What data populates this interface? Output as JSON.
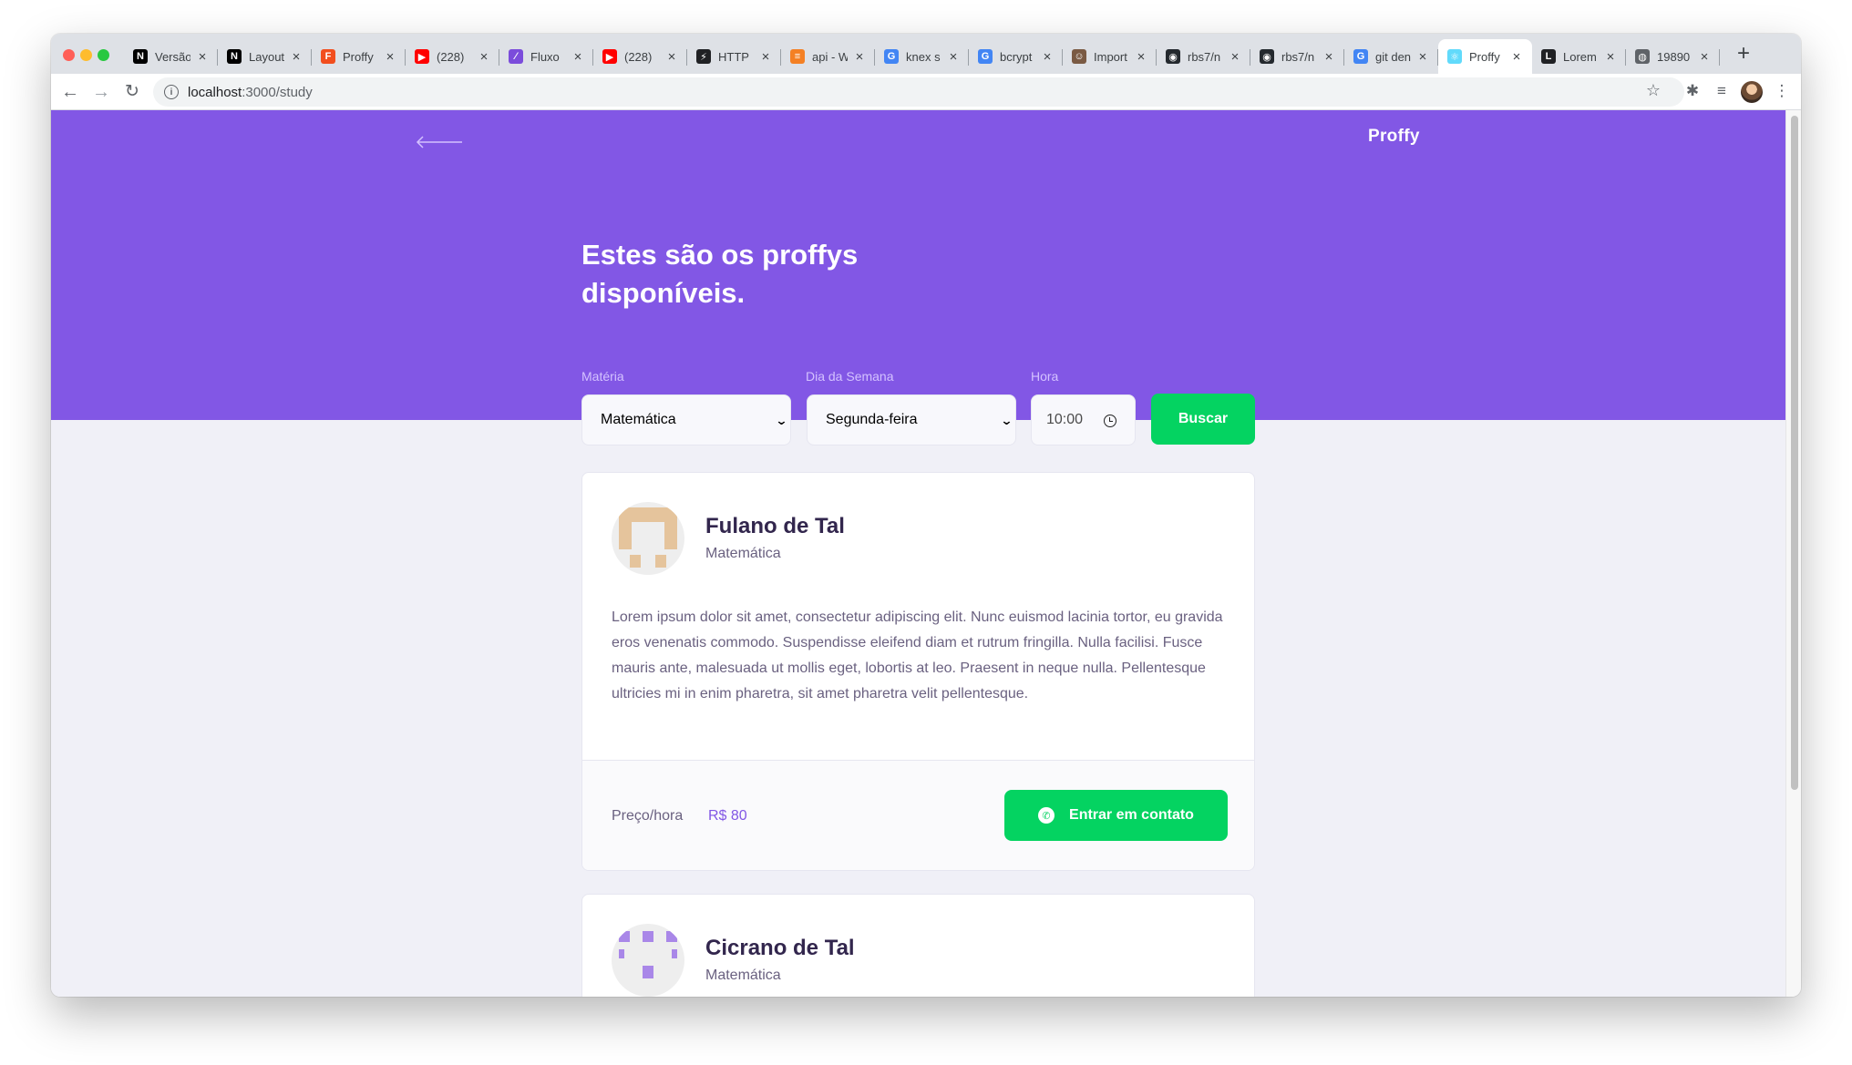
{
  "browser": {
    "tabs": [
      {
        "label": "Versão",
        "favicon": "notion-icon",
        "color": "#000000",
        "glyph": "N"
      },
      {
        "label": "Layout",
        "favicon": "notion-icon",
        "color": "#000000",
        "glyph": "N"
      },
      {
        "label": "Proffy",
        "favicon": "figma-icon",
        "color": "#f24e1e",
        "glyph": "F"
      },
      {
        "label": "(228)",
        "favicon": "youtube-icon",
        "color": "#ff0000",
        "glyph": "▶"
      },
      {
        "label": "Fluxo",
        "favicon": "whimsical-icon",
        "color": "#7b4cdb",
        "glyph": "⁄"
      },
      {
        "label": "(228)",
        "favicon": "youtube-icon",
        "color": "#ff0000",
        "glyph": "▶"
      },
      {
        "label": "HTTP",
        "favicon": "bolt-icon",
        "color": "#202124",
        "glyph": "⚡"
      },
      {
        "label": "api - W",
        "favicon": "stackoverflow-icon",
        "color": "#f48024",
        "glyph": "≡"
      },
      {
        "label": "knex s",
        "favicon": "google-icon",
        "color": "#4285f4",
        "glyph": "G"
      },
      {
        "label": "bcrypt",
        "favicon": "google-icon",
        "color": "#4285f4",
        "glyph": "G"
      },
      {
        "label": "Import",
        "favicon": "avatar-icon",
        "color": "#7a5a43",
        "glyph": "☺"
      },
      {
        "label": "rbs7/n",
        "favicon": "github-icon",
        "color": "#24292e",
        "glyph": "◉"
      },
      {
        "label": "rbs7/n",
        "favicon": "github-icon",
        "color": "#24292e",
        "glyph": "◉"
      },
      {
        "label": "git den",
        "favicon": "google-icon",
        "color": "#4285f4",
        "glyph": "G"
      },
      {
        "label": "Proffy",
        "favicon": "react-icon",
        "color": "#61dafb",
        "glyph": "⚛",
        "active": true
      },
      {
        "label": "Lorem",
        "favicon": "lorem-icon",
        "color": "#202124",
        "glyph": "L"
      },
      {
        "label": "19890",
        "favicon": "globe-icon",
        "color": "#5f6368",
        "glyph": "◍"
      }
    ],
    "url_host": "localhost",
    "url_path": ":3000/study"
  },
  "header": {
    "logo": "Proffy",
    "title": "Estes são os proffys disponíveis."
  },
  "filters": {
    "subject_label": "Matéria",
    "subject_value": "Matemática",
    "weekday_label": "Dia da Semana",
    "weekday_value": "Segunda-feira",
    "time_label": "Hora",
    "time_value": "10:00",
    "search_label": "Buscar"
  },
  "teachers": [
    {
      "name": "Fulano de Tal",
      "subject": "Matemática",
      "bio": "Lorem ipsum dolor sit amet, consectetur adipiscing elit. Nunc euismod lacinia tortor, eu gravida eros venenatis commodo. Suspendisse eleifend diam et rutrum fringilla. Nulla facilisi. Fusce mauris ante, malesuada ut mollis eget, lobortis at leo. Praesent in neque nulla. Pellentesque ultricies mi in enim pharetra, sit amet pharetra velit pellentesque.",
      "price_label": "Preço/hora",
      "price_value": "R$ 80",
      "contact_label": "Entrar em contato"
    },
    {
      "name": "Cicrano de Tal",
      "subject": "Matemática"
    }
  ],
  "colors": {
    "primary": "#8257e5",
    "secondary": "#04d361",
    "text_title": "#32264d",
    "text_base": "#6a6180"
  }
}
